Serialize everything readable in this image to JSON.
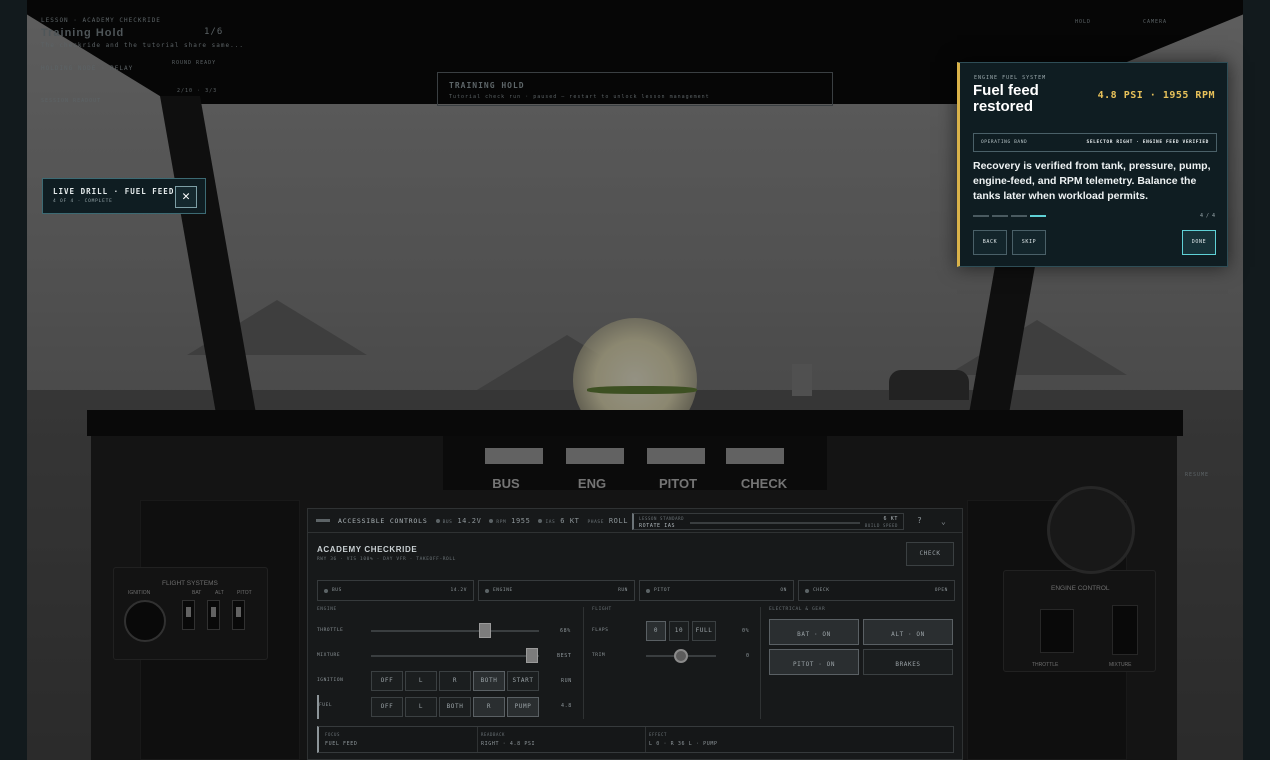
{
  "hud_bg": {
    "mission_kicker": "LESSON · ACADEMY CHECKRIDE",
    "mission_count": "1/6",
    "mission_title": "Training Hold",
    "mission_desc": "The checkride and the tutorial share same...",
    "mission_sub": "HOLDING NODE · RELAY",
    "mission_stat": "ROUND READY",
    "mission_stats": "2/10 · 3/3",
    "mission_footer": "SESSION READOUT",
    "center_title": "TRAINING HOLD",
    "center_sub": "Tutorial check run · paused — restart to unlock lesson management",
    "top_right_1": "HOLD",
    "top_right_2": "CAMERA",
    "right_hint": "RESUME"
  },
  "annunciators": [
    "BUS",
    "ENG",
    "PITOT",
    "CHECK"
  ],
  "flight_systems": {
    "title": "FLIGHT SYSTEMS",
    "ignition": "IGNITION",
    "switches": [
      "BAT",
      "ALT",
      "PITOT"
    ]
  },
  "engine_control": {
    "title": "ENGINE CONTROL",
    "throttle": "THROTTLE",
    "mixture": "MIXTURE"
  },
  "console": {
    "header": "ACCESSIBLE CONTROLS",
    "chips": [
      {
        "label": "BUS",
        "value": "14.2V"
      },
      {
        "label": "RPM",
        "value": "1955"
      },
      {
        "label": "IAS",
        "value": "6 KT"
      },
      {
        "label": "PHASE",
        "value": "ROLL"
      }
    ],
    "lesson_kicker": "LESSON STANDARD",
    "lesson_value": "ROTATE IAS",
    "lesson_kt": "6 KT",
    "lesson_build": "BUILD SPEED",
    "help": "?",
    "title": "ACADEMY CHECKRIDE",
    "subtitle": "RWY 36 · VIS 100% · DAY VFR · TAKEOFF-ROLL",
    "check_button": "CHECK",
    "status": [
      {
        "label": "BUS",
        "value": "14.2V"
      },
      {
        "label": "ENGINE",
        "value": "RUN"
      },
      {
        "label": "PITOT",
        "value": "ON"
      },
      {
        "label": "CHECK",
        "value": "OPEN"
      }
    ],
    "engine_heading": "ENGINE",
    "throttle_label": "THROTTLE",
    "throttle_value": "68%",
    "throttle_level": 0.68,
    "mixture_label": "MIXTURE",
    "mixture_value": "BEST",
    "mixture_level": 0.96,
    "ignition_label": "IGNITION",
    "ignition_options": [
      "OFF",
      "L",
      "R",
      "BOTH",
      "START"
    ],
    "ignition_value": "RUN",
    "fuel_label": "FUEL",
    "fuel_options": [
      "OFF",
      "L",
      "BOTH",
      "R",
      "PUMP"
    ],
    "fuel_value": "4.8",
    "flight_heading": "FLIGHT",
    "flaps_label": "FLAPS",
    "flaps_options": [
      "0",
      "10",
      "FULL"
    ],
    "flaps_value": "0%",
    "trim_label": "TRIM",
    "trim_value": "0",
    "elec_heading": "ELECTRICAL & GEAR",
    "elec_buttons": [
      "BAT · ON",
      "ALT · ON",
      "PITOT · ON",
      "BRAKES"
    ],
    "focus_kicker": "FOCUS",
    "focus_value": "FUEL FEED",
    "readback_kicker": "READBACK",
    "readback_value": "RIGHT · 4.8 PSI",
    "effect_kicker": "EFFECT",
    "effect_value": "L 0 · R 36 L · PUMP"
  },
  "drill": {
    "title": "LIVE DRILL · FUEL FEED",
    "sub": "4 OF 4 · COMPLETE",
    "close": "✕"
  },
  "card": {
    "kicker": "ENGINE FUEL SYSTEM",
    "title": "Fuel feed restored",
    "readout": "4.8 PSI · 1955 RPM",
    "status_label": "OPERATING BAND",
    "status_value": "SELECTOR RIGHT · ENGINE FEED VERIFIED",
    "body": "Recovery is verified from tank, pressure, pump, engine-feed, and RPM telemetry. Balance the tanks later when workload permits.",
    "step_count": "4 / 4",
    "steps_total": 4,
    "steps_active": 4,
    "back": "BACK",
    "skip": "SKIP",
    "done": "DONE"
  }
}
